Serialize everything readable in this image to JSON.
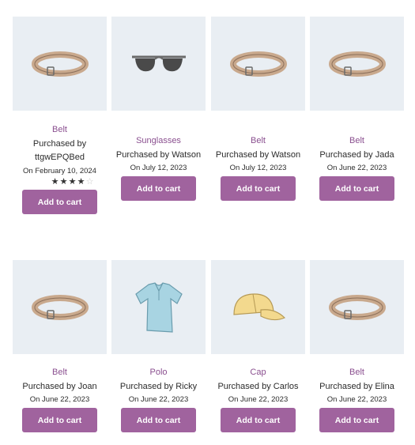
{
  "products": [
    {
      "category": "Belt",
      "title": "Purchased by ttgwEPQBed",
      "date": "On February 10, 2024",
      "rating": 4,
      "button": "Add to cart",
      "icon": "belt-icon"
    },
    {
      "category": "Sunglasses",
      "title": "Purchased by Watson",
      "date": "On July 12, 2023",
      "button": "Add to cart",
      "icon": "sunglasses-icon"
    },
    {
      "category": "Belt",
      "title": "Purchased by Watson",
      "date": "On July 12, 2023",
      "button": "Add to cart",
      "icon": "belt-icon"
    },
    {
      "category": "Belt",
      "title": "Purchased by Jada",
      "date": "On June 22, 2023",
      "button": "Add to cart",
      "icon": "belt-icon"
    },
    {
      "category": "Belt",
      "title": "Purchased by Joan",
      "date": "On June 22, 2023",
      "button": "Add to cart",
      "icon": "belt-icon"
    },
    {
      "category": "Polo",
      "title": "Purchased by Ricky",
      "date": "On June 22, 2023",
      "button": "Add to cart",
      "icon": "polo-shirt-icon"
    },
    {
      "category": "Cap",
      "title": "Purchased by Carlos",
      "date": "On June 22, 2023",
      "button": "Add to cart",
      "icon": "cap-icon"
    },
    {
      "category": "Belt",
      "title": "Purchased by Elina",
      "date": "On June 22, 2023",
      "button": "Add to cart",
      "icon": "belt-icon"
    }
  ],
  "colors": {
    "button": "#a0639e",
    "category": "#8a4f8f",
    "thumb_bg": "#e9eef3"
  }
}
